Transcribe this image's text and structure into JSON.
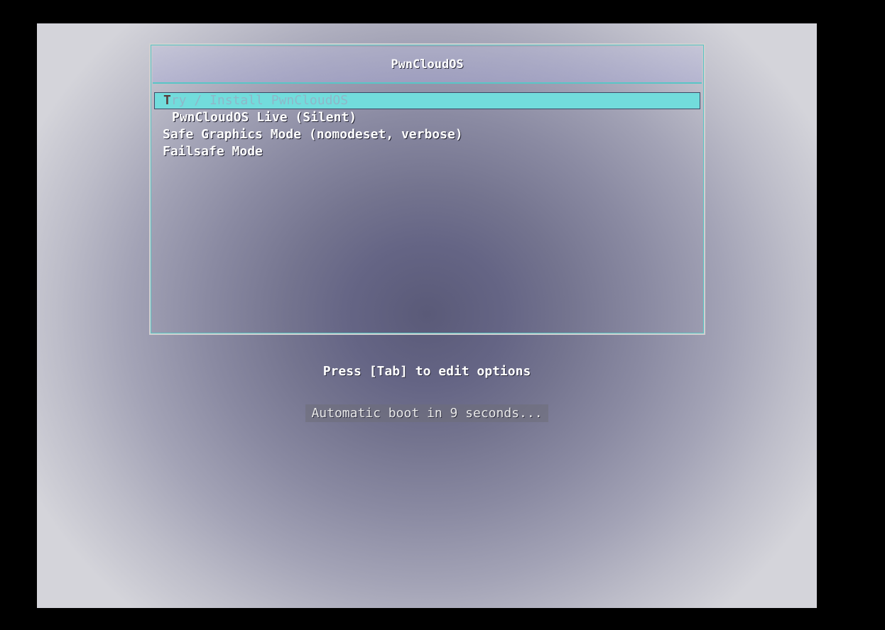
{
  "boot_menu": {
    "title": "PwnCloudOS",
    "items": [
      {
        "cursor": "T",
        "label": "ry / Install PwnCloudOS",
        "selected": true
      },
      {
        "label": "PwnCloudOS Live (Silent)"
      },
      {
        "label": "Safe Graphics Mode (nomodeset, verbose)"
      },
      {
        "label": "Failsafe Mode"
      }
    ]
  },
  "hint": "Press [Tab] to edit options",
  "countdown": "Automatic boot in 9 seconds...",
  "colors": {
    "highlight": "#72dcdc",
    "border_accent": "#58c6c6",
    "outer_background": "#000000"
  }
}
